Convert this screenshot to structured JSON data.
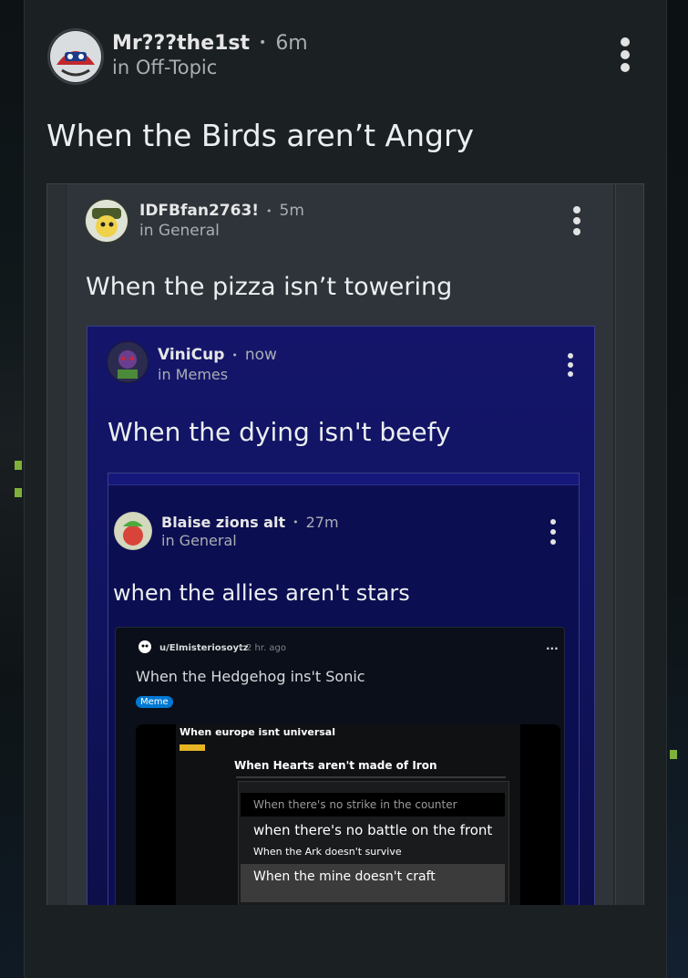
{
  "post": {
    "author": "Mr???the1st",
    "time": "6m",
    "community": "in Off-Topic",
    "title": "When the Birds aren’t Angry"
  },
  "embed1": {
    "author": "IDFBfan2763!",
    "time": "5m",
    "community": "in General",
    "title": "When the pizza isn’t towering"
  },
  "embed2": {
    "author": "ViniCup",
    "time": "now",
    "community": "in Memes",
    "title": "When the dying isn't beefy"
  },
  "embed3": {
    "author": "Blaise zions alt",
    "time": "27m",
    "community": "in General",
    "title": "when the allies aren't stars"
  },
  "reddit": {
    "user": "u/Elmisteriosoytz",
    "time": "2 hr. ago",
    "title": "When the Hedgehog ins't Sonic",
    "flair": "Meme",
    "more": "..."
  },
  "nested": {
    "europe": "When europe isnt universal",
    "hearts": "When Hearts aren't made of Iron",
    "strike": "When there's no strike in the counter",
    "battle": "when there's no battle on the front",
    "ark": "When the Ark doesn't survive",
    "mine": "When the mine doesn't craft"
  },
  "separator": "•"
}
